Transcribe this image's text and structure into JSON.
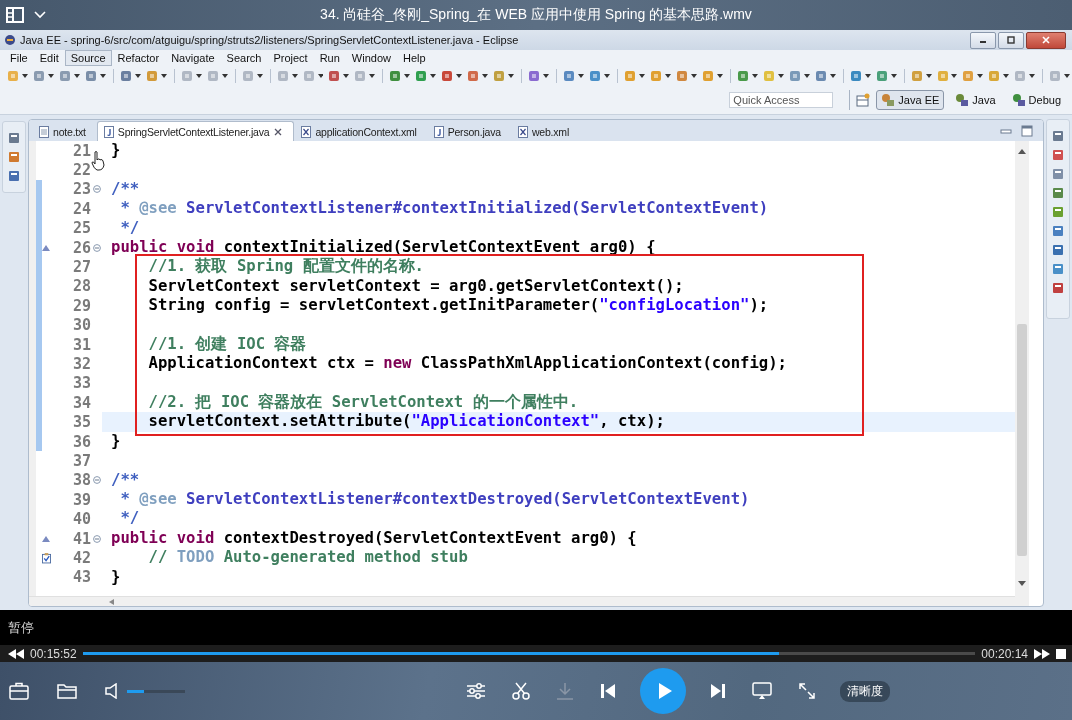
{
  "player": {
    "title": "34. 尚硅谷_佟刚_Spring_在 WEB 应用中使用 Spring 的基本思路.wmv",
    "status": "暂停",
    "elapsed": "00:15:52",
    "duration": "00:20:14",
    "progress": {
      "level": 0.78
    },
    "volume": {
      "level": 0.3
    },
    "download_disabled": true,
    "quality_button": "清晰度"
  },
  "eclipse": {
    "title": "Java EE - spring-6/src/com/atguigu/spring/struts2/listeners/SpringServletContextListener.java - Eclipse",
    "menu": [
      {
        "label": "File",
        "selected": false
      },
      {
        "label": "Edit",
        "selected": false
      },
      {
        "label": "Source",
        "selected": true
      },
      {
        "label": "Refactor",
        "selected": false
      },
      {
        "label": "Navigate",
        "selected": false
      },
      {
        "label": "Search",
        "selected": false
      },
      {
        "label": "Project",
        "selected": false
      },
      {
        "label": "Run",
        "selected": false
      },
      {
        "label": "Window",
        "selected": false
      },
      {
        "label": "Help",
        "selected": false
      }
    ],
    "quick_access": {
      "placeholder": "Quick Access"
    },
    "perspectives": [
      {
        "label": "Java EE",
        "selected": true
      },
      {
        "label": "Java",
        "selected": false
      },
      {
        "label": "Debug",
        "selected": false
      }
    ],
    "tabs": [
      {
        "label": "note.txt",
        "kind": "text",
        "selected": false
      },
      {
        "label": "SpringServletContextListener.java",
        "kind": "java",
        "selected": true
      },
      {
        "label": "applicationContext.xml",
        "kind": "xml",
        "selected": false
      },
      {
        "label": "Person.java",
        "kind": "java",
        "selected": false
      },
      {
        "label": "web.xml",
        "kind": "xml",
        "selected": false
      }
    ],
    "code_blocks": [
      {
        "boxed": false,
        "lines": [
          {
            "number": "21",
            "changed": false,
            "current": false,
            "fold": false,
            "override_marker": false,
            "task_marker": false,
            "tokens": [
              {
                "text": "}",
                "kind": "plain"
              }
            ]
          },
          {
            "number": "22",
            "changed": false,
            "current": false,
            "fold": false,
            "override_marker": false,
            "task_marker": false
          },
          {
            "number": "23",
            "changed": true,
            "current": false,
            "fold": true,
            "override_marker": false,
            "task_marker": false,
            "tokens": [
              {
                "text": "/**",
                "kind": "doc"
              }
            ]
          },
          {
            "number": "24",
            "changed": true,
            "current": false,
            "fold": false,
            "override_marker": false,
            "task_marker": false,
            "tokens": [
              {
                "text": " * ",
                "kind": "doc"
              },
              {
                "text": "@see",
                "kind": "doctag"
              },
              {
                "text": " ServletContextListener#contextInitialized(ServletContextEvent)",
                "kind": "doclink"
              }
            ]
          },
          {
            "number": "25",
            "changed": true,
            "current": false,
            "fold": false,
            "override_marker": false,
            "task_marker": false,
            "tokens": [
              {
                "text": " */",
                "kind": "doc"
              }
            ]
          },
          {
            "number": "26",
            "changed": true,
            "current": false,
            "fold": true,
            "override_marker": true,
            "task_marker": false,
            "tokens": [
              {
                "text": "public void",
                "kind": "keyword"
              },
              {
                "text": " contextInitialized(ServletContextEvent arg0) {",
                "kind": "plain"
              }
            ]
          }
        ]
      },
      {
        "boxed": true,
        "lines": [
          {
            "number": "27",
            "changed": true,
            "current": false,
            "fold": false,
            "override_marker": false,
            "task_marker": false,
            "tokens": [
              {
                "text": "    //1. 获取 Spring 配置文件的名称.",
                "kind": "comment"
              }
            ]
          },
          {
            "number": "28",
            "changed": true,
            "current": false,
            "fold": false,
            "override_marker": false,
            "task_marker": false,
            "tokens": [
              {
                "text": "    ServletContext servletContext = arg0.getServletContext();",
                "kind": "plain"
              }
            ]
          },
          {
            "number": "29",
            "changed": true,
            "current": false,
            "fold": false,
            "override_marker": false,
            "task_marker": false,
            "tokens": [
              {
                "text": "    String config = servletContext.getInitParameter(",
                "kind": "plain"
              },
              {
                "text": "\"configLocation\"",
                "kind": "string"
              },
              {
                "text": ");",
                "kind": "plain"
              }
            ]
          },
          {
            "number": "30",
            "changed": true,
            "current": false,
            "fold": false,
            "override_marker": false,
            "task_marker": false
          },
          {
            "number": "31",
            "changed": true,
            "current": false,
            "fold": false,
            "override_marker": false,
            "task_marker": false,
            "tokens": [
              {
                "text": "    //1. 创建 IOC 容器",
                "kind": "comment"
              }
            ]
          },
          {
            "number": "32",
            "changed": true,
            "current": false,
            "fold": false,
            "override_marker": false,
            "task_marker": false,
            "tokens": [
              {
                "text": "    ApplicationContext ctx = ",
                "kind": "plain"
              },
              {
                "text": "new",
                "kind": "keyword"
              },
              {
                "text": " ClassPathXmlApplicationContext(config);",
                "kind": "plain"
              }
            ]
          },
          {
            "number": "33",
            "changed": true,
            "current": false,
            "fold": false,
            "override_marker": false,
            "task_marker": false
          },
          {
            "number": "34",
            "changed": true,
            "current": false,
            "fold": false,
            "override_marker": false,
            "task_marker": false,
            "tokens": [
              {
                "text": "    //2. 把 IOC 容器放在 ServletContext 的一个属性中.",
                "kind": "comment"
              }
            ]
          },
          {
            "number": "35",
            "changed": true,
            "current": true,
            "fold": false,
            "override_marker": false,
            "task_marker": false,
            "tokens": [
              {
                "text": "    servletContext.setAttribute(",
                "kind": "plain"
              },
              {
                "text": "\"ApplicationContext\"",
                "kind": "string"
              },
              {
                "text": ", ctx);",
                "kind": "plain"
              }
            ]
          }
        ]
      },
      {
        "boxed": false,
        "lines": [
          {
            "number": "36",
            "changed": true,
            "current": false,
            "fold": false,
            "override_marker": false,
            "task_marker": false,
            "tokens": [
              {
                "text": "}",
                "kind": "plain"
              }
            ]
          },
          {
            "number": "37",
            "changed": false,
            "current": false,
            "fold": false,
            "override_marker": false,
            "task_marker": false
          },
          {
            "number": "38",
            "changed": false,
            "current": false,
            "fold": true,
            "override_marker": false,
            "task_marker": false,
            "tokens": [
              {
                "text": "/**",
                "kind": "doc"
              }
            ]
          },
          {
            "number": "39",
            "changed": false,
            "current": false,
            "fold": false,
            "override_marker": false,
            "task_marker": false,
            "tokens": [
              {
                "text": " * ",
                "kind": "doc"
              },
              {
                "text": "@see",
                "kind": "doctag"
              },
              {
                "text": " ServletContextListener#contextDestroyed(ServletContextEvent)",
                "kind": "doclink"
              }
            ]
          },
          {
            "number": "40",
            "changed": false,
            "current": false,
            "fold": false,
            "override_marker": false,
            "task_marker": false,
            "tokens": [
              {
                "text": " */",
                "kind": "doc"
              }
            ]
          },
          {
            "number": "41",
            "changed": false,
            "current": false,
            "fold": true,
            "override_marker": true,
            "task_marker": false,
            "tokens": [
              {
                "text": "public void",
                "kind": "keyword"
              },
              {
                "text": " contextDestroyed(ServletContextEvent arg0) {",
                "kind": "plain"
              }
            ]
          },
          {
            "number": "42",
            "changed": false,
            "current": false,
            "fold": false,
            "override_marker": false,
            "task_marker": true,
            "tokens": [
              {
                "text": "    // ",
                "kind": "comment"
              },
              {
                "text": "TODO",
                "kind": "todo"
              },
              {
                "text": " Auto-generated method stub",
                "kind": "comment"
              }
            ]
          },
          {
            "number": "43",
            "changed": false,
            "current": false,
            "fold": false,
            "override_marker": false,
            "task_marker": false,
            "tokens": [
              {
                "text": "}",
                "kind": "plain"
              }
            ]
          }
        ]
      }
    ]
  }
}
